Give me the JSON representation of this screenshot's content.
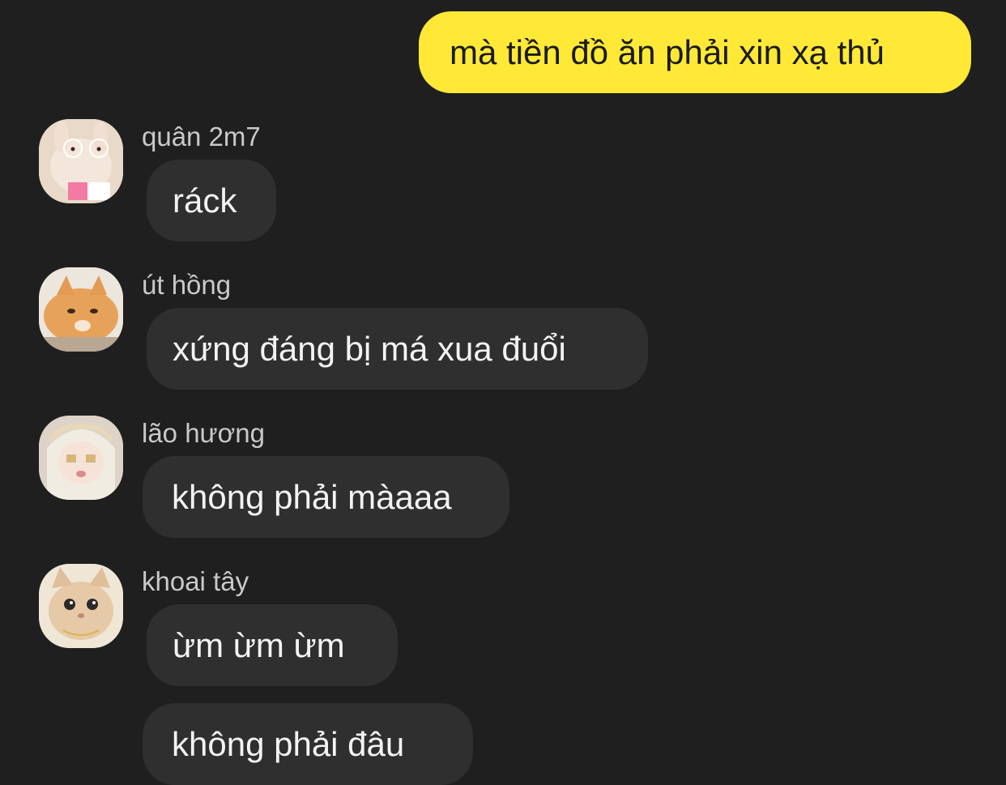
{
  "outgoing": [
    {
      "text": "mà tiền đồ ăn phải xin xạ thủ"
    }
  ],
  "groups": [
    {
      "sender": "quân 2m7",
      "avatar_icon": "bunny-with-glasses-avatar-icon",
      "messages": [
        "ráck"
      ]
    },
    {
      "sender": "út hồng",
      "avatar_icon": "orange-cat-avatar-icon",
      "messages": [
        "xứng đáng bị má xua đuổi"
      ]
    },
    {
      "sender": "lão hương",
      "avatar_icon": "anime-girl-avatar-icon",
      "messages": [
        "không phải màaaa"
      ]
    },
    {
      "sender": "khoai tây",
      "avatar_icon": "cream-cat-avatar-icon",
      "messages": [
        "ừm ừm ừm",
        "không phải đâu"
      ]
    }
  ],
  "colors": {
    "background": "#1f1f1f",
    "outgoing_bubble": "#ffe936",
    "incoming_bubble": "#2f2f2f",
    "sender_name": "#c9c9c9"
  }
}
